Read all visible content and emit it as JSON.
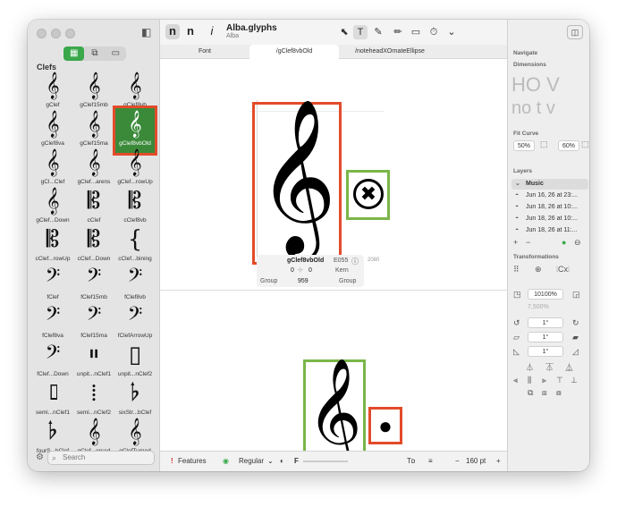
{
  "app": {
    "title": "Alba.glyphs",
    "subtitle": "Alba"
  },
  "toolbar": {
    "mode_n1": "n",
    "mode_n2": "n",
    "info_i": "i",
    "select_tool": "⬉",
    "text_tool": "T",
    "pen_tool": "✎",
    "pencil_tool": "✏",
    "rect_tool": "▭",
    "measure_tool": "⏱",
    "more_tool": "⌄",
    "sidebar_toggle": "▣"
  },
  "tabs": [
    {
      "label": "Font"
    },
    {
      "label": "/gClef8vbOld"
    },
    {
      "label": "/noteheadXOrnateEllipse"
    }
  ],
  "sidebar": {
    "category": "Clefs",
    "search_placeholder": "Search",
    "glyphs": [
      {
        "name": "gClef",
        "glyph": "𝄞"
      },
      {
        "name": "gClef15mb",
        "glyph": "𝄞"
      },
      {
        "name": "gClef8vb",
        "glyph": "𝄞"
      },
      {
        "name": "gClef8va",
        "glyph": "𝄞"
      },
      {
        "name": "gClef15ma",
        "glyph": "𝄞"
      },
      {
        "name": "gClef8vbOld",
        "glyph": "𝄞"
      },
      {
        "name": "gCl...Clef",
        "glyph": "𝄞"
      },
      {
        "name": "gClef...arens",
        "glyph": "𝄞"
      },
      {
        "name": "gClef...rowUp",
        "glyph": "𝄞"
      },
      {
        "name": "gClef...Down",
        "glyph": "𝄞"
      },
      {
        "name": "cClef",
        "glyph": "𝄡"
      },
      {
        "name": "cClef8vb",
        "glyph": "𝄡"
      },
      {
        "name": "cClef...rowUp",
        "glyph": "𝄡"
      },
      {
        "name": "cClef...Down",
        "glyph": "𝄡"
      },
      {
        "name": "cClef...bining",
        "glyph": "{"
      },
      {
        "name": "fClef",
        "glyph": "𝄢"
      },
      {
        "name": "fClef15mb",
        "glyph": "𝄢"
      },
      {
        "name": "fClef8vb",
        "glyph": "𝄢"
      },
      {
        "name": "fClef8va",
        "glyph": "𝄢"
      },
      {
        "name": "fClef15ma",
        "glyph": "𝄢"
      },
      {
        "name": "fClefArrowUp",
        "glyph": "𝄢"
      },
      {
        "name": "fClef...Down",
        "glyph": "𝄢"
      },
      {
        "name": "unpit...nClef1",
        "glyph": "𝄥"
      },
      {
        "name": "unpit...nClef2",
        "glyph": "▯"
      },
      {
        "name": "semi...nClef1",
        "glyph": "𝄦"
      },
      {
        "name": "semi...nClef2",
        "glyph": "⁞"
      },
      {
        "name": "sixStr...bClef",
        "glyph": "𝄬"
      },
      {
        "name": "fourS...bClef",
        "glyph": "𝄬"
      },
      {
        "name": "gClef...ersed",
        "glyph": "𝄞"
      },
      {
        "name": "gClefTurned",
        "glyph": "𝄞"
      }
    ]
  },
  "canvas": {
    "upper_clef": "𝄞",
    "upper_notehead": "✖",
    "lower_clef": "𝄞",
    "lower_notehead": "●",
    "ruler_labels": [
      "0",
      "959",
      "0",
      "0",
      "2080"
    ],
    "info": {
      "glyph_name": "gClef8vbOld",
      "unicode": "E055",
      "left_sb": "0",
      "right_sb": "0",
      "width": "959",
      "left_group": "Group",
      "right_group": "Group",
      "kern": "Kern"
    }
  },
  "bottombar": {
    "features_label": "Features",
    "master": "Regular",
    "zoom": "160 pt",
    "minus": "−",
    "plus": "+",
    "f_label": "F"
  },
  "panel": {
    "navigate": "Navigate",
    "dimensions": "Dimensions",
    "dims_text1": "HO V",
    "dims_text2": "no t v",
    "fit_curve": "Fit Curve",
    "fit_50": "50%",
    "fit_60": "60%",
    "layers": "Layers",
    "layer_list": [
      {
        "name": "Music"
      },
      {
        "name": "Jun 16, 26 at 23:..."
      },
      {
        "name": "Jun 18, 26 at 10:..."
      },
      {
        "name": "Jun 18, 26 at 10:..."
      },
      {
        "name": "Jun 18, 26 at 11:..."
      }
    ],
    "transformations": "Transformations",
    "scale": "10100%",
    "scale2": "7,500%",
    "rotate": "1°",
    "slant": "1°",
    "skew": "1°"
  },
  "colors": {
    "selection_red": "#e34b2a",
    "selection_green": "#7ab648",
    "accent_green": "#39a84a"
  }
}
